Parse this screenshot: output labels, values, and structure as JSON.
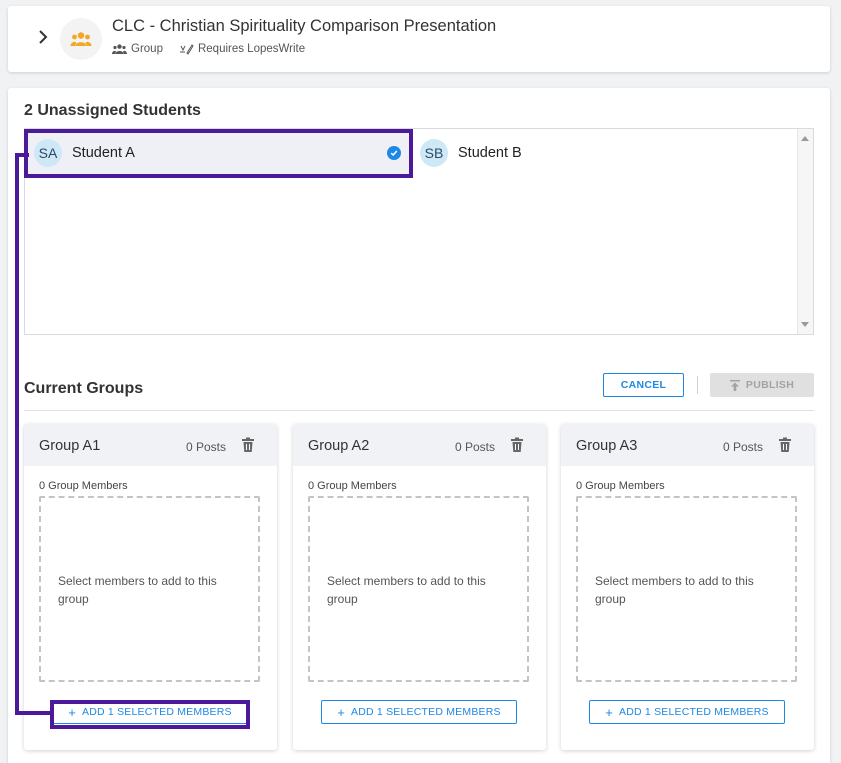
{
  "header": {
    "title": "CLC - Christian Spirituality Comparison Presentation",
    "meta": [
      {
        "icon": "people-icon",
        "label": "Group"
      },
      {
        "icon": "signature-icon",
        "label": "Requires LopesWrite"
      }
    ]
  },
  "unassigned": {
    "title": "2 Unassigned Students",
    "students": [
      {
        "initials": "SA",
        "name": "Student A",
        "selected": true
      },
      {
        "initials": "SB",
        "name": "Student B",
        "selected": false
      }
    ]
  },
  "groups_section": {
    "title": "Current Groups",
    "cancel_label": "CANCEL",
    "publish_label": "PUBLISH"
  },
  "groups": [
    {
      "name": "Group A1",
      "posts": "0 Posts",
      "members": "0 Group Members",
      "empty_text": "Select members to add to this group",
      "add_label": "ADD 1 SELECTED MEMBERS"
    },
    {
      "name": "Group A2",
      "posts": "0 Posts",
      "members": "0 Group Members",
      "empty_text": "Select members to add to this group",
      "add_label": "ADD 1 SELECTED MEMBERS"
    },
    {
      "name": "Group A3",
      "posts": "0 Posts",
      "members": "0 Group Members",
      "empty_text": "Select members to add to this group",
      "add_label": "ADD 1 SELECTED MEMBERS"
    }
  ],
  "colors": {
    "accent": "#1e88e5",
    "highlight": "#4a1a9a",
    "group_icon": "#f5a623"
  }
}
